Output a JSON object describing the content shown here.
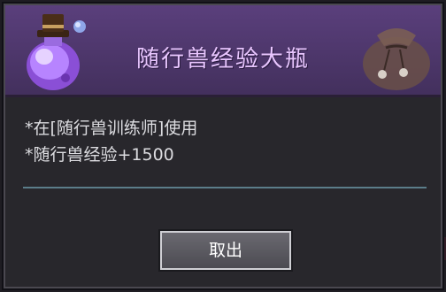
{
  "popup": {
    "title": "随行兽经验大瓶",
    "lines": [
      "*在[随行兽训练师]使用",
      "*随行兽经验+1500"
    ],
    "button_label": "取出"
  },
  "icons": {
    "item": "purple-potion-icon",
    "decor": "sack-icon",
    "left_arrow": "chevron-left-icon",
    "right_arrow": "chevron-right-icon"
  },
  "colors": {
    "header_bg": "#4e3870",
    "title_text": "#e9c6ff",
    "body_text": "#dcdce0",
    "divider": "#5b7d8a"
  }
}
